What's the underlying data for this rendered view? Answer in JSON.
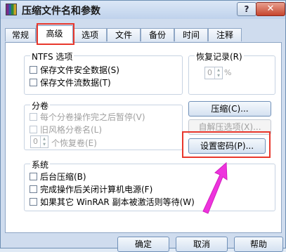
{
  "window": {
    "title": "压缩文件名和参数",
    "help": "?",
    "close": "✕"
  },
  "tabs": [
    "常规",
    "高级",
    "选项",
    "文件",
    "备份",
    "时间",
    "注释"
  ],
  "ntfs": {
    "label": "NTFS 选项",
    "items": [
      "保存文件安全数据(S)",
      "保存文件流数据(T)"
    ]
  },
  "recovery": {
    "label": "恢复记录(R)",
    "value": "0",
    "unit": "%"
  },
  "volumes": {
    "label": "分卷",
    "items": [
      "每个分卷操作完之后暂停(V)",
      "旧风格分卷名(L)"
    ],
    "spin_value": "0",
    "spin_label": "个恢复卷(E)"
  },
  "buttons": {
    "compress": "压缩(C)...",
    "sfx": "自解压选项(X)...",
    "set_password": "设置密码(P)..."
  },
  "system": {
    "label": "系统",
    "items": [
      "后台压缩(B)",
      "完成操作后关闭计算机电源(F)",
      "如果其它 WinRAR 副本被激活则等待(W)"
    ]
  },
  "footer": {
    "ok": "确定",
    "cancel": "取消",
    "help": "帮助"
  },
  "colors": {
    "highlight": "#e8372c",
    "arrow": "#ee33dd"
  }
}
